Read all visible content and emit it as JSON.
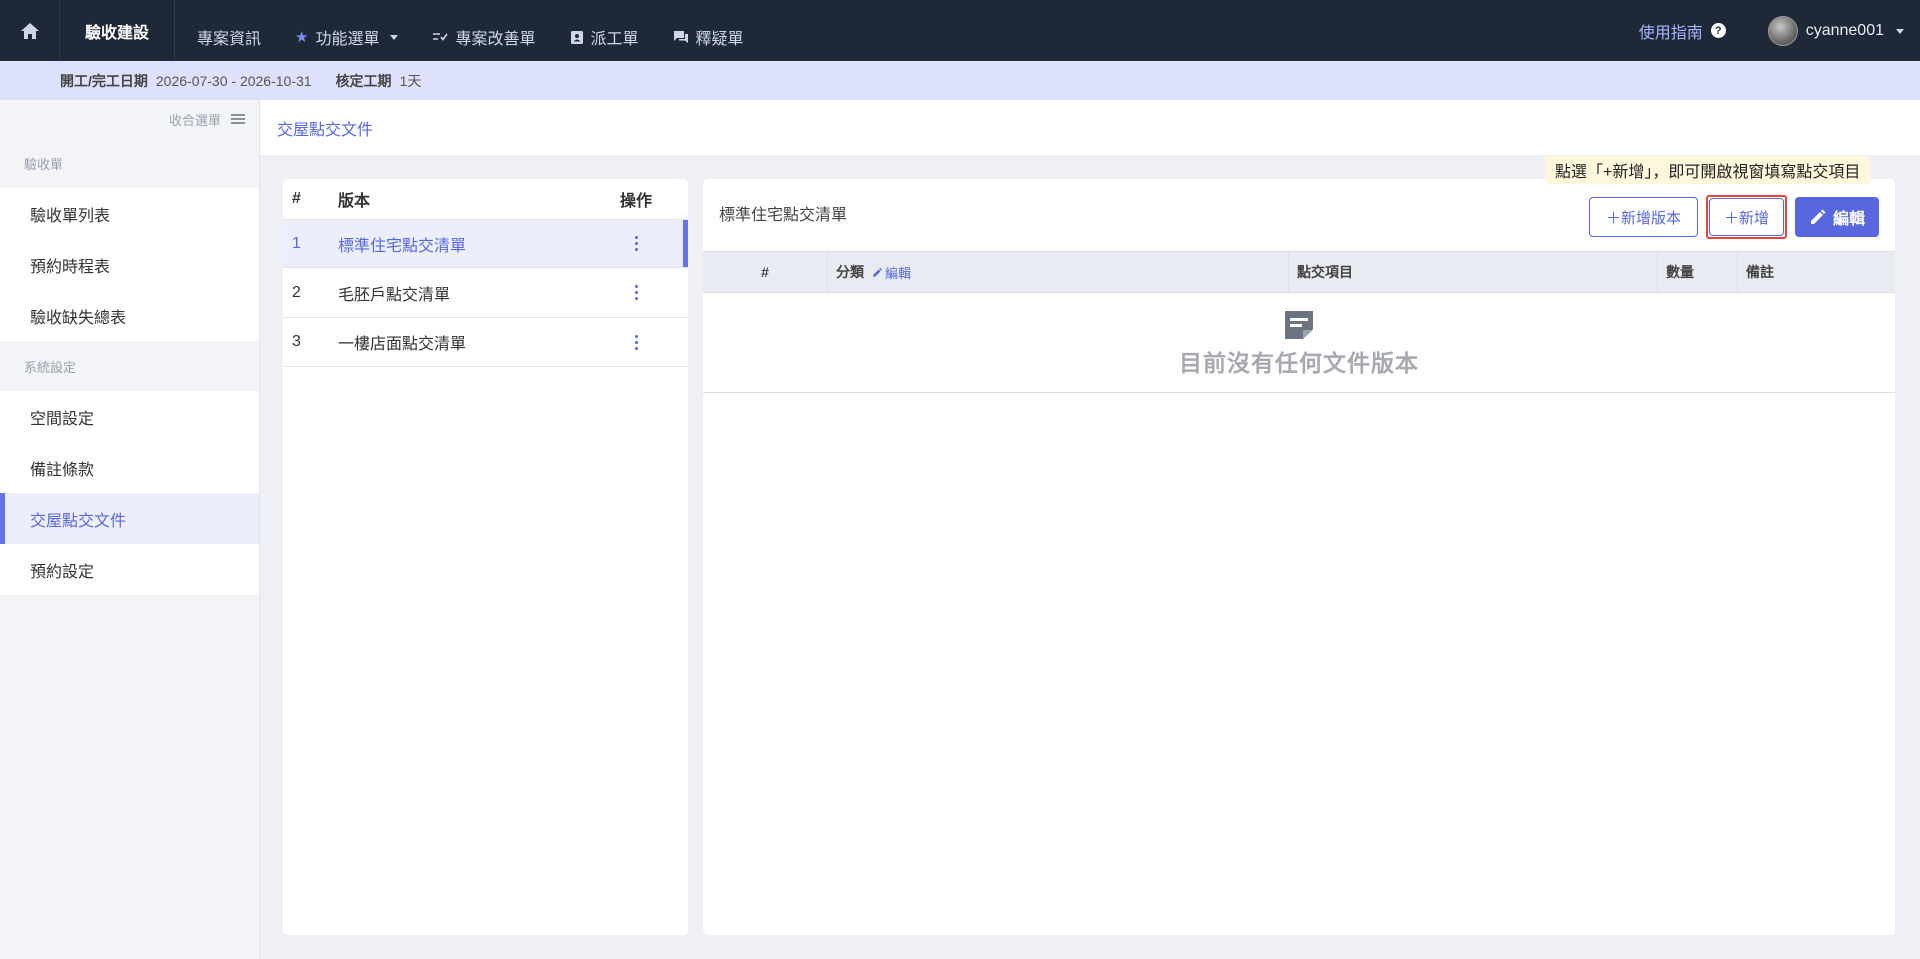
{
  "topnav": {
    "brand": "驗收建設",
    "items": [
      {
        "label": "專案資訊"
      },
      {
        "label": "功能選單"
      },
      {
        "label": "專案改善單"
      },
      {
        "label": "派工單"
      },
      {
        "label": "釋疑單"
      }
    ],
    "guide": "使用指南",
    "guide_icon": "?",
    "username": "cyanne001"
  },
  "infobar": {
    "date_label": "開工/完工日期",
    "date_value": "2026-07-30 - 2026-10-31",
    "period_label": "核定工期",
    "period_value": "1天"
  },
  "sidebar": {
    "collapse_label": "收合選單",
    "groups": [
      {
        "title": "驗收單",
        "items": [
          {
            "label": "驗收單列表"
          },
          {
            "label": "預約時程表"
          },
          {
            "label": "驗收缺失總表"
          }
        ]
      },
      {
        "title": "系統設定",
        "items": [
          {
            "label": "空間設定"
          },
          {
            "label": "備註條款"
          },
          {
            "label": "交屋點交文件"
          },
          {
            "label": "預約設定"
          }
        ]
      }
    ],
    "active_item": "交屋點交文件"
  },
  "breadcrumb": "交屋點交文件",
  "versions": {
    "headers": {
      "num": "#",
      "name": "版本",
      "op": "操作"
    },
    "rows": [
      {
        "num": "1",
        "name": "標準住宅點交清單"
      },
      {
        "num": "2",
        "name": "毛胚戶點交清單"
      },
      {
        "num": "3",
        "name": "一樓店面點交清單"
      }
    ]
  },
  "detail": {
    "title": "標準住宅點交清單",
    "add_version_btn": "＋新增版本",
    "add_btn": "＋新增",
    "edit_btn": "編輯",
    "tooltip": "點選「+新增」，即可開啟視窗填寫點交項目",
    "headers": {
      "num": "#",
      "category": "分類",
      "category_edit": "編輯",
      "item": "點交項目",
      "qty": "數量",
      "note": "備註"
    },
    "empty_text": "目前沒有任何文件版本"
  },
  "colors": {
    "accent": "#5867dd",
    "nav_bg": "#1e2837",
    "highlight": "#e6453e"
  }
}
